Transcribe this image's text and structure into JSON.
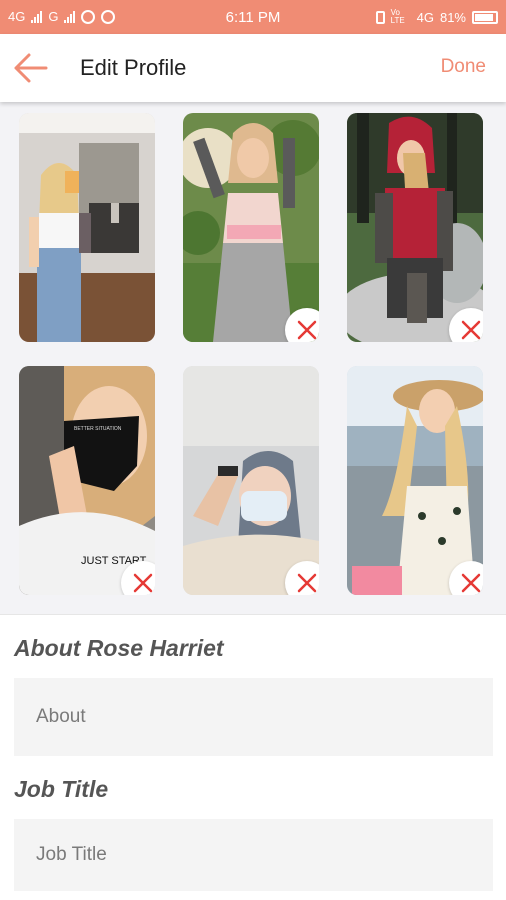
{
  "status_bar": {
    "left_net1": "4G",
    "left_net2": "G",
    "time": "6:11 PM",
    "volte": "Vo LTE",
    "right_net": "4G",
    "battery": "81%"
  },
  "header": {
    "title": "Edit Profile",
    "done_label": "Done"
  },
  "photos": [
    {
      "name": "photo-1",
      "deletable": false
    },
    {
      "name": "photo-2",
      "deletable": true
    },
    {
      "name": "photo-3",
      "deletable": true
    },
    {
      "name": "photo-4",
      "deletable": true
    },
    {
      "name": "photo-5",
      "deletable": true
    },
    {
      "name": "photo-6",
      "deletable": true
    }
  ],
  "shirt_text": "JUST START",
  "mask_text": "BETTER SITUATION",
  "about": {
    "label": "About Rose Harriet",
    "placeholder": "About",
    "value": ""
  },
  "job": {
    "label": "Job Title",
    "placeholder": "Job Title",
    "value": ""
  },
  "colors": {
    "accent": "#f08c74",
    "delete": "#e53935"
  }
}
